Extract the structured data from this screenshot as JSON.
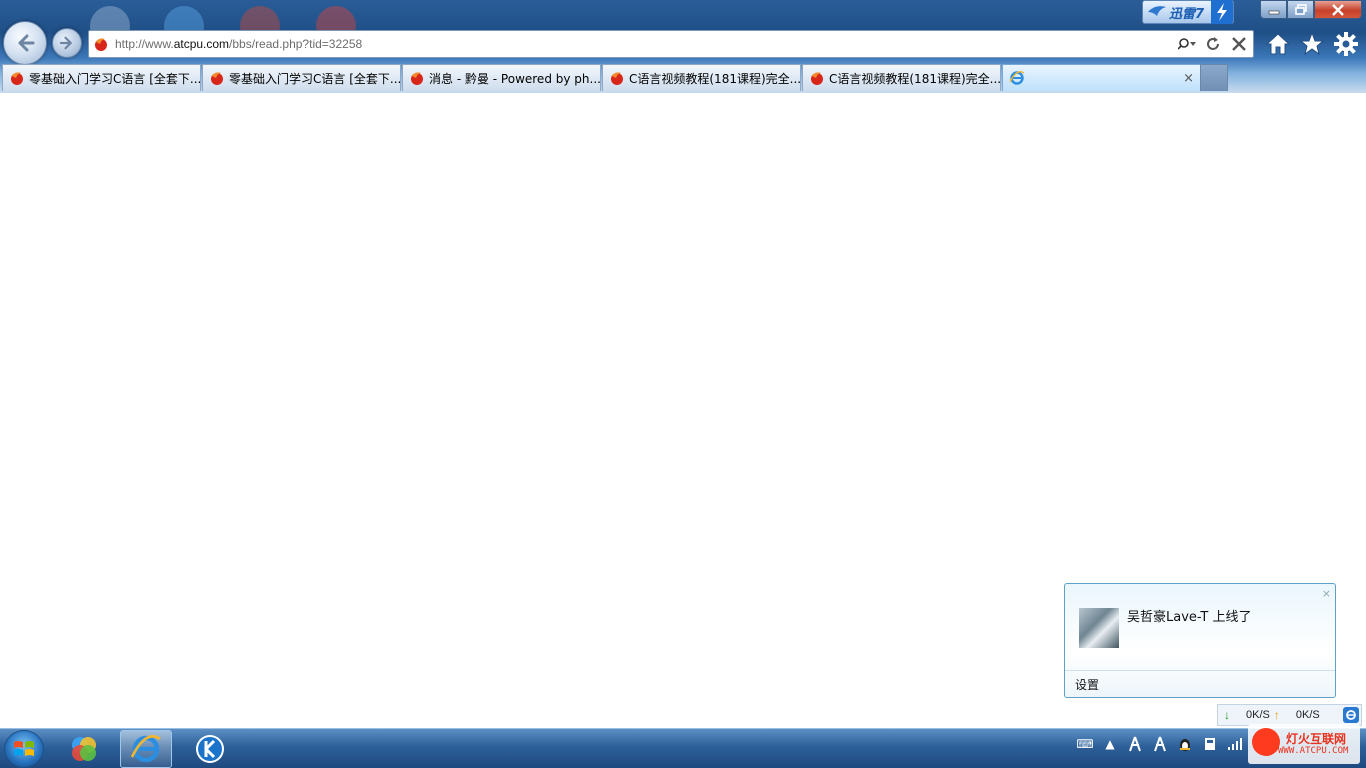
{
  "browser": {
    "address": {
      "prefix": "http://www.",
      "domain": "atcpu.com",
      "path": "/bbs/read.php?tid=32258"
    },
    "tabs": [
      {
        "label": "零基础入门学习C语言 [全套下...",
        "active": false
      },
      {
        "label": "零基础入门学习C语言 [全套下...",
        "active": false
      },
      {
        "label": "消息 - 黔曼 - Powered by ph...",
        "active": false
      },
      {
        "label": "C语言视频教程(181课程)完全...",
        "active": false
      },
      {
        "label": "C语言视频教程(181课程)完全...",
        "active": false
      },
      {
        "label": "",
        "active": true
      }
    ],
    "active_tab_close": "×",
    "thunder_badge": "迅雷7"
  },
  "notification": {
    "message": "吴哲豪Lave-T 上线了",
    "settings_label": "设置",
    "close": "×"
  },
  "speed": {
    "down": "0K/S",
    "up": "0K/S"
  },
  "watermark": {
    "name": "灯火互联网",
    "url": "WWW.ATCPU.COM"
  },
  "colors": {
    "accent": "#1f4f86",
    "tab_active": "#bfe0fb",
    "close_red": "#c7412a"
  }
}
